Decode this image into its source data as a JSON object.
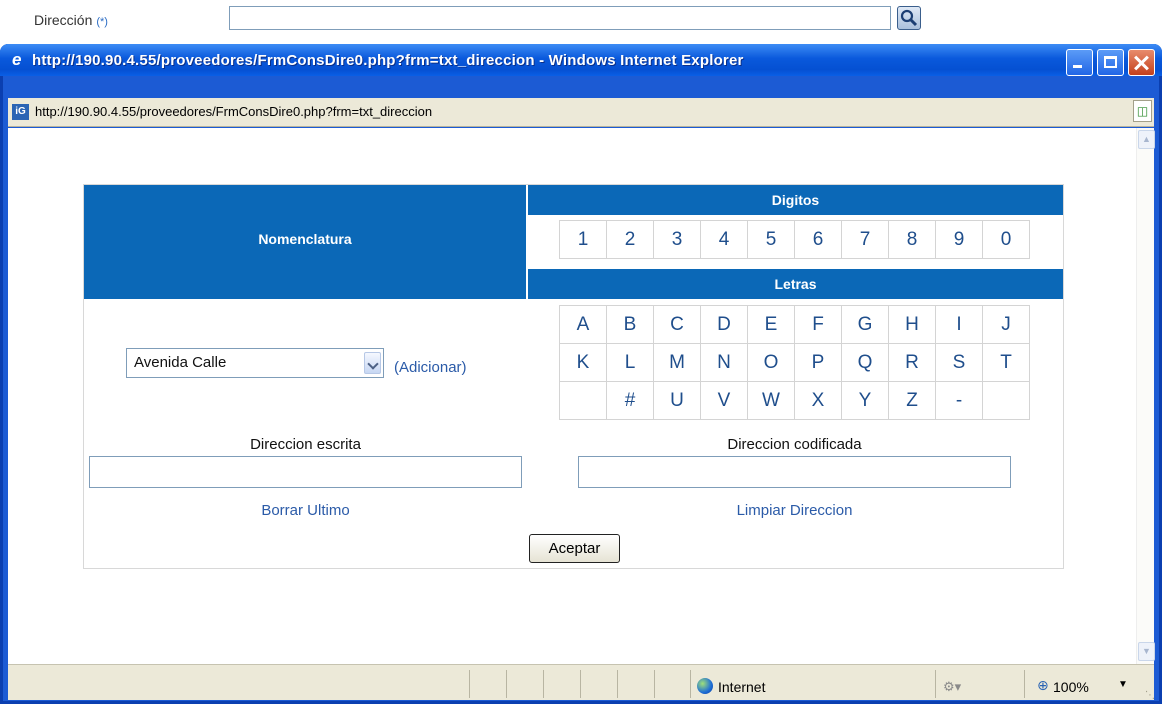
{
  "parent_form": {
    "label": "Dirección",
    "required_mark": "(*)",
    "value": ""
  },
  "window": {
    "title": "http://190.90.4.55/proveedores/FrmConsDire0.php?frm=txt_direccion - Windows Internet Explorer",
    "address": "http://190.90.4.55/proveedores/FrmConsDire0.php?frm=txt_direccion",
    "address_icon": "iG"
  },
  "form": {
    "nomenclatura_header": "Nomenclatura",
    "digitos_header": "Digitos",
    "letras_header": "Letras",
    "digits": [
      "1",
      "2",
      "3",
      "4",
      "5",
      "6",
      "7",
      "8",
      "9",
      "0"
    ],
    "letter_rows": [
      [
        "A",
        "B",
        "C",
        "D",
        "E",
        "F",
        "G",
        "H",
        "I",
        "J"
      ],
      [
        "K",
        "L",
        "M",
        "N",
        "O",
        "P",
        "Q",
        "R",
        "S",
        "T"
      ],
      [
        "",
        "#",
        "U",
        "V",
        "W",
        "X",
        "Y",
        "Z",
        "-",
        ""
      ]
    ],
    "select_value": "Avenida Calle",
    "adicionar": "(Adicionar)",
    "escrita_label": "Direccion escrita",
    "codificada_label": "Direccion codificada",
    "escrita_value": "",
    "codificada_value": "",
    "borrar": "Borrar Ultimo",
    "limpiar": "Limpiar Direccion",
    "aceptar": "Aceptar"
  },
  "status": {
    "zone": "Internet",
    "zoom": "100%"
  },
  "icons": {
    "search": "search-icon",
    "ie": "ie-logo-icon",
    "globe": "globe-icon"
  }
}
